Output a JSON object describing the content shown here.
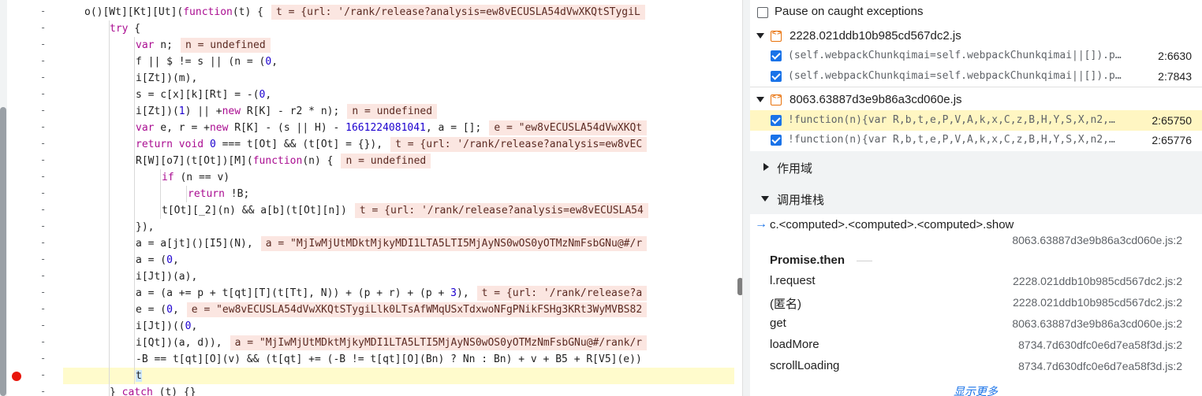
{
  "editor": {
    "lines": [
      {
        "segments": [
          [
            "",
            ""
          ],
          [
            "o()[Wt][Kt][Ut](",
            ""
          ],
          [
            "function",
            "kw"
          ],
          [
            "(t) {",
            ""
          ]
        ],
        "inline": "t = {url: '/rank/release?analysis=ew8vECUSLA54dVwXKQtSTygiL"
      },
      {
        "segments": [
          [
            "try",
            "kw"
          ],
          [
            " {",
            ""
          ]
        ],
        "inline": ""
      },
      {
        "segments": [
          [
            "var",
            "kw"
          ],
          [
            " n;",
            ""
          ]
        ],
        "inline": "n = undefined"
      },
      {
        "segments": [
          [
            "f || $ != s || (n = (",
            ""
          ],
          [
            "0",
            "num"
          ],
          [
            ",",
            ""
          ]
        ],
        "inline": ""
      },
      {
        "segments": [
          [
            "i[Zt])(m),",
            ""
          ]
        ],
        "inline": ""
      },
      {
        "segments": [
          [
            "s = c[x][k][Rt] = -(",
            ""
          ],
          [
            "0",
            "num"
          ],
          [
            ",",
            ""
          ]
        ],
        "inline": ""
      },
      {
        "segments": [
          [
            "i[Zt])(",
            ""
          ],
          [
            "1",
            "num"
          ],
          [
            ") || +",
            ""
          ],
          [
            "new",
            "kw"
          ],
          [
            " R[K] - r2 * n);",
            ""
          ]
        ],
        "inline": "n = undefined"
      },
      {
        "segments": [
          [
            "var",
            "kw"
          ],
          [
            " e, r = +",
            ""
          ],
          [
            "new",
            "kw"
          ],
          [
            " R[K] - (s || H) - ",
            ""
          ],
          [
            "1661224081041",
            "num"
          ],
          [
            ", a = [];",
            ""
          ]
        ],
        "inline": "e = \"ew8vECUSLA54dVwXKQt"
      },
      {
        "segments": [
          [
            "return",
            "kw"
          ],
          [
            " ",
            ""
          ],
          [
            "void",
            "kw"
          ],
          [
            " ",
            ""
          ],
          [
            "0",
            "num"
          ],
          [
            " === t[Ot] && (t[Ot] = {}),",
            ""
          ]
        ],
        "inline": "t = {url: '/rank/release?analysis=ew8vEC"
      },
      {
        "segments": [
          [
            "R[W][o7](t[Ot])[M](",
            ""
          ],
          [
            "function",
            "kw"
          ],
          [
            "(n) {",
            ""
          ]
        ],
        "inline": "n = undefined"
      },
      {
        "segments": [
          [
            "if",
            "kw"
          ],
          [
            " (n == v)",
            ""
          ]
        ],
        "inline": ""
      },
      {
        "segments": [
          [
            "return",
            "kw"
          ],
          [
            " !B;",
            ""
          ]
        ],
        "inline": ""
      },
      {
        "segments": [
          [
            "t[Ot][_2](n) && a[b](t[Ot][n])",
            ""
          ]
        ],
        "inline": "t = {url: '/rank/release?analysis=ew8vECUSLA54"
      },
      {
        "segments": [
          [
            "}),",
            ""
          ]
        ],
        "inline": ""
      },
      {
        "segments": [
          [
            "a = a[jt]()[I5](N),",
            ""
          ]
        ],
        "inline": "a = \"MjIwMjUtMDktMjkyMDI1LTA5LTI5MjAyNS0wOS0yOTMzNmFsbGNu@#/r"
      },
      {
        "segments": [
          [
            "a = (",
            ""
          ],
          [
            "0",
            "num"
          ],
          [
            ",",
            ""
          ]
        ],
        "inline": ""
      },
      {
        "segments": [
          [
            "i[Jt])(a),",
            ""
          ]
        ],
        "inline": ""
      },
      {
        "segments": [
          [
            "a = (a += p + t[qt][T](t[Tt], N)) + (p + r) + (p + ",
            ""
          ],
          [
            "3",
            "num"
          ],
          [
            "),",
            ""
          ]
        ],
        "inline": "t = {url: '/rank/release?a"
      },
      {
        "segments": [
          [
            "e = (",
            ""
          ],
          [
            "0",
            "num"
          ],
          [
            ",",
            ""
          ]
        ],
        "inline": "e = \"ew8vECUSLA54dVwXKQtSTygiLlk0LTsAfWMqUSxTdxwoNFgPNikFSHg3KRt3WyMVBS82"
      },
      {
        "segments": [
          [
            "i[Jt])((",
            ""
          ],
          [
            "0",
            "num"
          ],
          [
            ",",
            ""
          ]
        ],
        "inline": ""
      },
      {
        "segments": [
          [
            "i[Qt])(a, d)),",
            ""
          ]
        ],
        "inline": "a = \"MjIwMjUtMDktMjkyMDI1LTA5LTI5MjAyNS0wOS0yOTMzNmFsbGNu@#/rank/r"
      },
      {
        "segments": [
          [
            "-B == t[qt][O](v) && (t[qt] += (-B != t[qt][O](Bn) ? Nn : Bn) + v + B5 + R[V5](e))",
            ""
          ]
        ],
        "inline": ""
      },
      {
        "segments": [
          [
            "t",
            "cursor"
          ]
        ],
        "inline": ""
      },
      {
        "segments": [
          [
            "} ",
            ""
          ],
          [
            "catch",
            "kw"
          ],
          [
            " (t) {}",
            ""
          ]
        ],
        "inline": ""
      }
    ],
    "gutter_mark": "-"
  },
  "sidebar": {
    "pause_caught_label": "Pause on caught exceptions",
    "files": [
      {
        "name": "2228.021ddb10b985cd567dc2.js",
        "breakpoints": [
          {
            "code": "(self.webpackChunkqimai=self.webpackChunkqimai||[]).p…",
            "loc": "2:6630"
          },
          {
            "code": "(self.webpackChunkqimai=self.webpackChunkqimai||[]).p…",
            "loc": "2:7843"
          }
        ]
      },
      {
        "name": "8063.63887d3e9b86a3cd060e.js",
        "breakpoints": [
          {
            "code": "!function(n){var R,b,t,e,P,V,A,k,x,C,z,B,H,Y,S,X,n2,…",
            "loc": "2:65750"
          },
          {
            "code": "!function(n){var R,b,t,e,P,V,A,k,x,C,z,B,H,Y,S,X,n2,…",
            "loc": "2:65776"
          }
        ]
      }
    ],
    "scope_label": "作用域",
    "callstack_label": "调用堆栈",
    "current_frame": {
      "name": "c.<computed>.<computed>.<computed>.show",
      "loc": "8063.63887d3e9b86a3cd060e.js:2"
    },
    "async_label": "Promise.then",
    "frames": [
      {
        "name": "l.request",
        "loc": "2228.021ddb10b985cd567dc2.js:2"
      },
      {
        "name": "(匿名)",
        "loc": "2228.021ddb10b985cd567dc2.js:2"
      },
      {
        "name": "get",
        "loc": "8063.63887d3e9b86a3cd060e.js:2"
      },
      {
        "name": "loadMore",
        "loc": "8734.7d630dfc0e6d7ea58f3d.js:2"
      },
      {
        "name": "scrollLoading",
        "loc": "8734.7d630dfc0e6d7ea58f3d.js:2"
      }
    ],
    "show_more_label": "显示更多"
  }
}
